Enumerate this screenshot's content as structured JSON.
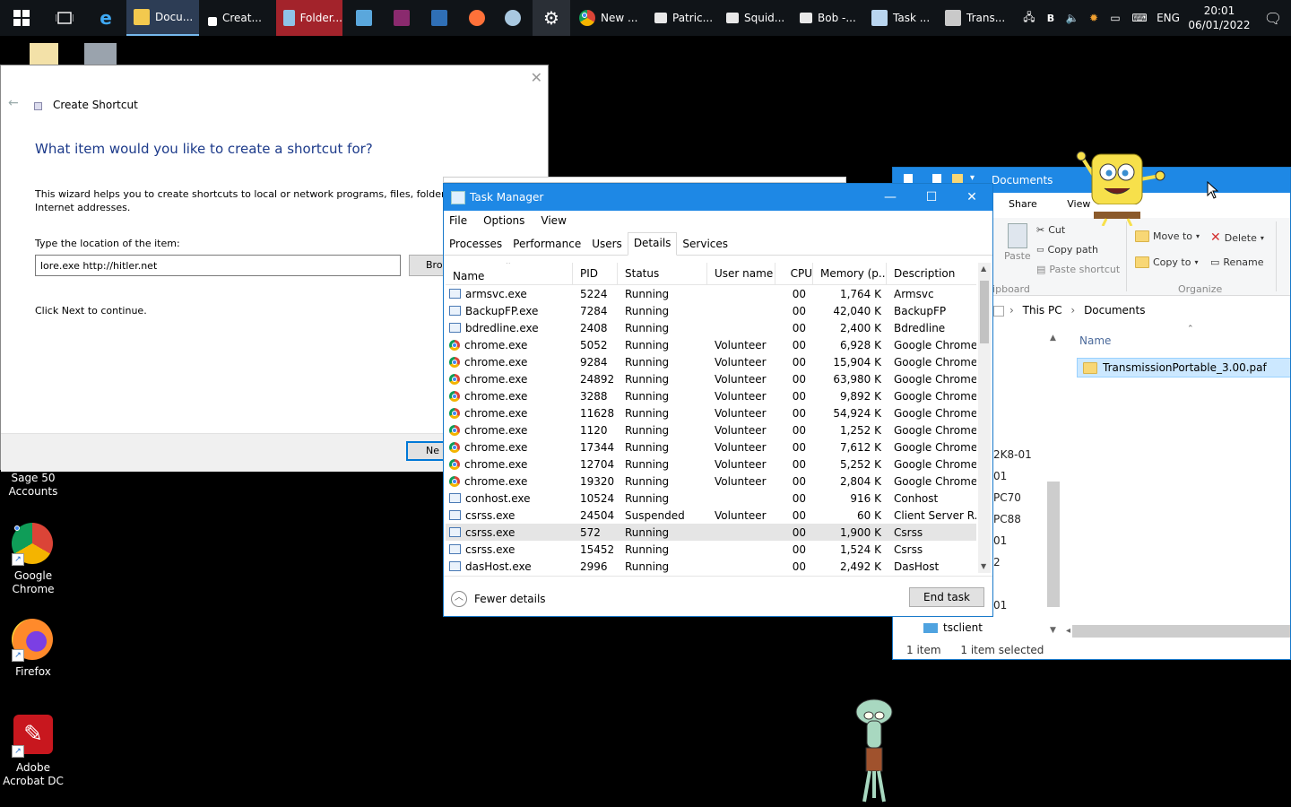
{
  "taskbar": {
    "tasks": [
      {
        "label": "Docu...",
        "icon": "explorer-icon"
      },
      {
        "label": "Creat...",
        "icon": "shortcut-icon"
      },
      {
        "label": "Folder...",
        "icon": "folder-app-icon"
      },
      {
        "label": "New ...",
        "icon": "chrome-icon"
      },
      {
        "label": "Patric...",
        "icon": "patrick-icon"
      },
      {
        "label": "Squid...",
        "icon": "squidward-icon"
      },
      {
        "label": "Bob -...",
        "icon": "spongebob-icon"
      },
      {
        "label": "Task ...",
        "icon": "taskmgr-icon"
      },
      {
        "label": "Trans...",
        "icon": "transmission-icon"
      }
    ],
    "tray": {
      "lang": "ENG",
      "letter": "B",
      "time": "20:01",
      "date": "06/01/2022"
    }
  },
  "desktop": {
    "icons": [
      {
        "label": "Sage 50 Accounts"
      },
      {
        "label": "Google Chrome"
      },
      {
        "label": "Firefox"
      },
      {
        "label": "Adobe Acrobat DC"
      }
    ]
  },
  "wizard": {
    "title": "Create Shortcut",
    "heading": "What item would you like to create a shortcut for?",
    "description": "This wizard helps you to create shortcuts to local or network programs, files, folders, c",
    "description2": "Internet addresses.",
    "location_label": "Type the location of the item:",
    "location_value": "lore.exe http://hitler.net",
    "browse_label": "Bro",
    "continue_text": "Click Next to continue.",
    "next_label": "Ne"
  },
  "explorer": {
    "title": "Documents",
    "ribbon_tabs": [
      "Share",
      "View"
    ],
    "clipboard": {
      "cut": "Cut",
      "copy_path": "Copy path",
      "paste": "Paste",
      "paste_shortcut": "Paste shortcut",
      "group": "lipboard"
    },
    "organize": {
      "move_to": "Move to",
      "copy_to": "Copy to",
      "delete": "Delete",
      "rename": "Rename",
      "group": "Organize"
    },
    "breadcrumb": [
      "This PC",
      "Documents"
    ],
    "column_name": "Name",
    "file": "TransmissionPortable_3.00.paf",
    "nav_fragments": [
      "2K8-01",
      "01",
      "PC70",
      "PC88",
      "01",
      "2",
      "01"
    ],
    "nav_tsclient": "tsclient",
    "status_count": "1 item",
    "status_selected": "1 item selected"
  },
  "taskmgr": {
    "title": "Task Manager",
    "menu": [
      "File",
      "Options",
      "View"
    ],
    "tabs": [
      "Processes",
      "Performance",
      "Users",
      "Details",
      "Services"
    ],
    "selected_tab": "Details",
    "columns": [
      "Name",
      "PID",
      "Status",
      "User name",
      "CPU",
      "Memory (p...",
      "Description"
    ],
    "rows": [
      {
        "name": "armsvc.exe",
        "pid": "5224",
        "status": "Running",
        "user": "",
        "cpu": "00",
        "mem": "1,764 K",
        "desc": "Armsvc",
        "icon": "app"
      },
      {
        "name": "BackupFP.exe",
        "pid": "7284",
        "status": "Running",
        "user": "",
        "cpu": "00",
        "mem": "42,040 K",
        "desc": "BackupFP",
        "icon": "app"
      },
      {
        "name": "bdredline.exe",
        "pid": "2408",
        "status": "Running",
        "user": "",
        "cpu": "00",
        "mem": "2,400 K",
        "desc": "Bdredline",
        "icon": "app"
      },
      {
        "name": "chrome.exe",
        "pid": "5052",
        "status": "Running",
        "user": "Volunteer",
        "cpu": "00",
        "mem": "6,928 K",
        "desc": "Google Chrome",
        "icon": "chrome"
      },
      {
        "name": "chrome.exe",
        "pid": "9284",
        "status": "Running",
        "user": "Volunteer",
        "cpu": "00",
        "mem": "15,904 K",
        "desc": "Google Chrome",
        "icon": "chrome"
      },
      {
        "name": "chrome.exe",
        "pid": "24892",
        "status": "Running",
        "user": "Volunteer",
        "cpu": "00",
        "mem": "63,980 K",
        "desc": "Google Chrome",
        "icon": "chrome"
      },
      {
        "name": "chrome.exe",
        "pid": "3288",
        "status": "Running",
        "user": "Volunteer",
        "cpu": "00",
        "mem": "9,892 K",
        "desc": "Google Chrome",
        "icon": "chrome"
      },
      {
        "name": "chrome.exe",
        "pid": "11628",
        "status": "Running",
        "user": "Volunteer",
        "cpu": "00",
        "mem": "54,924 K",
        "desc": "Google Chrome",
        "icon": "chrome"
      },
      {
        "name": "chrome.exe",
        "pid": "1120",
        "status": "Running",
        "user": "Volunteer",
        "cpu": "00",
        "mem": "1,252 K",
        "desc": "Google Chrome",
        "icon": "chrome"
      },
      {
        "name": "chrome.exe",
        "pid": "17344",
        "status": "Running",
        "user": "Volunteer",
        "cpu": "00",
        "mem": "7,612 K",
        "desc": "Google Chrome",
        "icon": "chrome"
      },
      {
        "name": "chrome.exe",
        "pid": "12704",
        "status": "Running",
        "user": "Volunteer",
        "cpu": "00",
        "mem": "5,252 K",
        "desc": "Google Chrome",
        "icon": "chrome"
      },
      {
        "name": "chrome.exe",
        "pid": "19320",
        "status": "Running",
        "user": "Volunteer",
        "cpu": "00",
        "mem": "2,804 K",
        "desc": "Google Chrome",
        "icon": "chrome"
      },
      {
        "name": "conhost.exe",
        "pid": "10524",
        "status": "Running",
        "user": "",
        "cpu": "00",
        "mem": "916 K",
        "desc": "Conhost",
        "icon": "app"
      },
      {
        "name": "csrss.exe",
        "pid": "24504",
        "status": "Suspended",
        "user": "Volunteer",
        "cpu": "00",
        "mem": "60 K",
        "desc": "Client Server R...",
        "icon": "app"
      },
      {
        "name": "csrss.exe",
        "pid": "572",
        "status": "Running",
        "user": "",
        "cpu": "00",
        "mem": "1,900 K",
        "desc": "Csrss",
        "icon": "app",
        "selected": true
      },
      {
        "name": "csrss.exe",
        "pid": "15452",
        "status": "Running",
        "user": "",
        "cpu": "00",
        "mem": "1,524 K",
        "desc": "Csrss",
        "icon": "app"
      },
      {
        "name": "dasHost.exe",
        "pid": "2996",
        "status": "Running",
        "user": "",
        "cpu": "00",
        "mem": "2,492 K",
        "desc": "DasHost",
        "icon": "app"
      }
    ],
    "fewer_details": "Fewer details",
    "end_task": "End task"
  },
  "colors": {
    "accent": "#1e88e5",
    "taskbar": "#101418",
    "heading": "#1c3a8a",
    "selection": "#cce8ff"
  }
}
